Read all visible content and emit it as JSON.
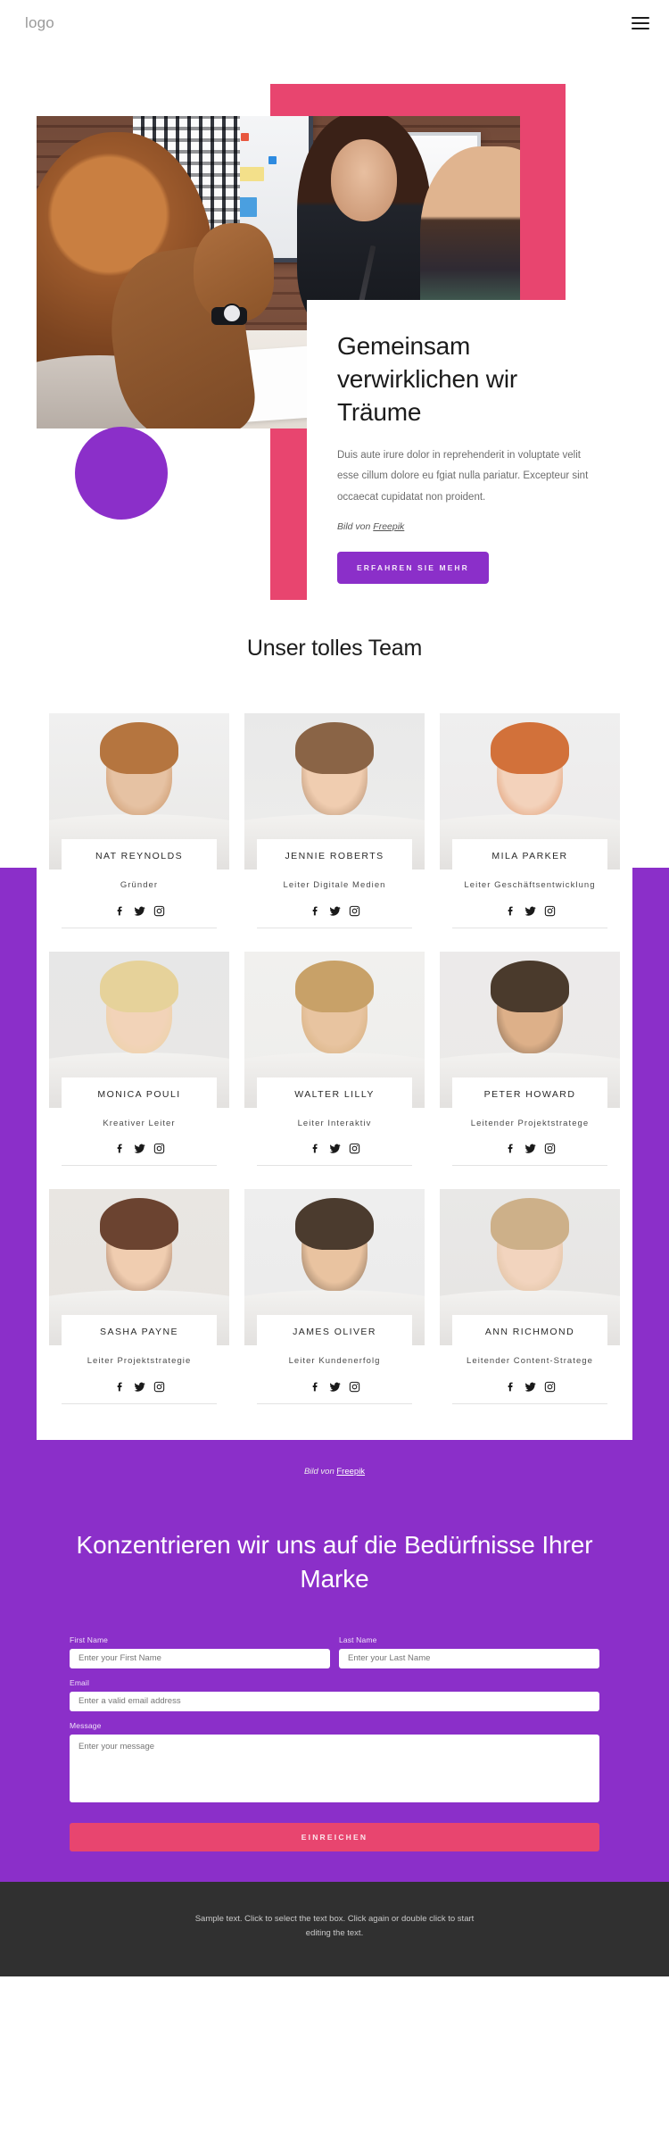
{
  "header": {
    "logo": "logo",
    "menu_icon": "hamburger-menu-icon"
  },
  "hero": {
    "title": "Gemeinsam verwirklichen wir Träume",
    "paragraph": "Duis aute irure dolor in reprehenderit in voluptate velit esse cillum dolore eu fgiat nulla pariatur. Excepteur sint occaecat cupidatat non proident.",
    "credit_prefix": "Bild von ",
    "credit_link": "Freepik",
    "cta_label": "ERFAHREN SIE MEHR"
  },
  "team": {
    "title": "Unser tolles Team",
    "members": [
      {
        "name": "NAT REYNOLDS",
        "role": "Gründer"
      },
      {
        "name": "JENNIE ROBERTS",
        "role": "Leiter Digitale Medien"
      },
      {
        "name": "MILA PARKER",
        "role": "Leiter Geschäftsentwicklung"
      },
      {
        "name": "MONICA POULI",
        "role": "Kreativer Leiter"
      },
      {
        "name": "WALTER LILLY",
        "role": "Leiter Interaktiv"
      },
      {
        "name": "PETER HOWARD",
        "role": "Leitender Projektstratege"
      },
      {
        "name": "SASHA PAYNE",
        "role": "Leiter Projektstrategie"
      },
      {
        "name": "JAMES OLIVER",
        "role": "Leiter Kundenerfolg"
      },
      {
        "name": "ANN RICHMOND",
        "role": "Leitender Content-Stratege"
      }
    ],
    "social_icons": [
      "facebook-icon",
      "twitter-icon",
      "instagram-icon"
    ]
  },
  "cta": {
    "credit_prefix": "Bild von ",
    "credit_link": "Freepik",
    "title": "Konzentrieren wir uns auf die Bedürfnisse Ihrer Marke",
    "form": {
      "first_name_label": "First Name",
      "first_name_placeholder": "Enter your First Name",
      "last_name_label": "Last Name",
      "last_name_placeholder": "Enter your Last Name",
      "email_label": "Email",
      "email_placeholder": "Enter a valid email address",
      "message_label": "Message",
      "message_placeholder": "Enter your message",
      "submit_label": "EINREICHEN"
    }
  },
  "footer": {
    "text": "Sample text. Click to select the text box. Click again or double click to start editing the text."
  },
  "colors": {
    "purple": "#8b2fc9",
    "pink": "#e8456f",
    "dark": "#303030"
  }
}
